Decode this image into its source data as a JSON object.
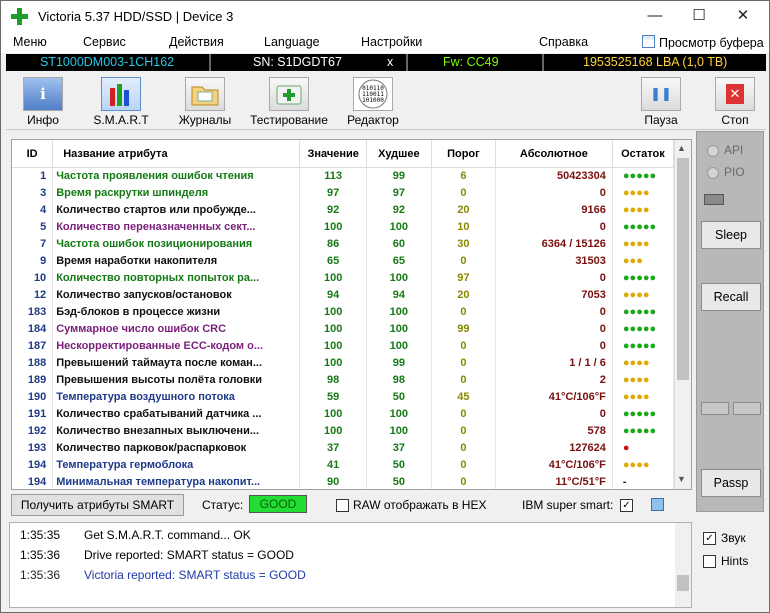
{
  "window": {
    "title": "Victoria 5.37 HDD/SSD | Device 3"
  },
  "menu": {
    "items": [
      "Меню",
      "Сервис",
      "Действия",
      "Language",
      "Настройки",
      "Справка"
    ],
    "buffer_view": "Просмотр буфера"
  },
  "device": {
    "model": "ST1000DM003-1CH162",
    "serial": "SN: S1DGDT67",
    "close": "x",
    "firmware": "Fw: CC49",
    "capacity": "1953525168 LBA (1,0 TB)"
  },
  "toolbar": {
    "info": "Инфо",
    "smart": "S.M.A.R.T",
    "logs": "Журналы",
    "test": "Тестирование",
    "editor": "Редактор",
    "pause": "Пауза",
    "stop": "Стоп",
    "editor_icon_text": "010110\n110011\n101000\n011011"
  },
  "table": {
    "headers": [
      "ID",
      "Название атрибута",
      "Значение",
      "Худшее",
      "Порог",
      "Абсолютное",
      "Остаток"
    ],
    "rows": [
      {
        "id": "1",
        "name": "Частота проявления ошибок чтения",
        "value": "113",
        "worst": "99",
        "thresh": "6",
        "abs": "50423304",
        "rem": "●●●●●",
        "nc": "#157a15",
        "rc": "#18a818"
      },
      {
        "id": "3",
        "name": "Время раскрутки шпинделя",
        "value": "97",
        "worst": "97",
        "thresh": "0",
        "abs": "0",
        "rem": "●●●●",
        "nc": "#157a15",
        "rc": "#e0a800"
      },
      {
        "id": "4",
        "name": "Количество стартов или пробужде...",
        "value": "92",
        "worst": "92",
        "thresh": "20",
        "abs": "9166",
        "rem": "●●●●",
        "nc": "#111",
        "rc": "#e0a800"
      },
      {
        "id": "5",
        "name": "Количество переназначенных сект...",
        "value": "100",
        "worst": "100",
        "thresh": "10",
        "abs": "0",
        "rem": "●●●●●",
        "nc": "#7a1f7a",
        "rc": "#18a818"
      },
      {
        "id": "7",
        "name": "Частота ошибок позиционирования",
        "value": "86",
        "worst": "60",
        "thresh": "30",
        "abs": "6364 / 15126",
        "rem": "●●●●",
        "nc": "#157a15",
        "rc": "#e0a800"
      },
      {
        "id": "9",
        "name": "Время наработки накопителя",
        "value": "65",
        "worst": "65",
        "thresh": "0",
        "abs": "31503",
        "rem": "●●●",
        "nc": "#111",
        "rc": "#e0a800"
      },
      {
        "id": "10",
        "name": "Количество повторных попыток ра...",
        "value": "100",
        "worst": "100",
        "thresh": "97",
        "abs": "0",
        "rem": "●●●●●",
        "nc": "#157a15",
        "rc": "#18a818"
      },
      {
        "id": "12",
        "name": "Количество запусков/остановок",
        "value": "94",
        "worst": "94",
        "thresh": "20",
        "abs": "7053",
        "rem": "●●●●",
        "nc": "#111",
        "rc": "#e0a800"
      },
      {
        "id": "183",
        "name": "Бэд-блоков в процессе жизни",
        "value": "100",
        "worst": "100",
        "thresh": "0",
        "abs": "0",
        "rem": "●●●●●",
        "nc": "#111",
        "rc": "#18a818"
      },
      {
        "id": "184",
        "name": "Суммарное число ошибок CRC",
        "value": "100",
        "worst": "100",
        "thresh": "99",
        "abs": "0",
        "rem": "●●●●●",
        "nc": "#7a1f7a",
        "rc": "#18a818"
      },
      {
        "id": "187",
        "name": "Нескорректированные ECC-кодом о...",
        "value": "100",
        "worst": "100",
        "thresh": "0",
        "abs": "0",
        "rem": "●●●●●",
        "nc": "#7a1f7a",
        "rc": "#18a818"
      },
      {
        "id": "188",
        "name": "Превышений таймаута после коман...",
        "value": "100",
        "worst": "99",
        "thresh": "0",
        "abs": "1 / 1 / 6",
        "rem": "●●●●",
        "nc": "#111",
        "rc": "#e0a800"
      },
      {
        "id": "189",
        "name": "Превышения высоты полёта головки",
        "value": "98",
        "worst": "98",
        "thresh": "0",
        "abs": "2",
        "rem": "●●●●",
        "nc": "#111",
        "rc": "#e0a800"
      },
      {
        "id": "190",
        "name": "Температура воздушного потока",
        "value": "59",
        "worst": "50",
        "thresh": "45",
        "abs": "41°C/106°F",
        "rem": "●●●●",
        "nc": "#1f3a8a",
        "rc": "#e0a800"
      },
      {
        "id": "191",
        "name": "Количество срабатываний датчика ...",
        "value": "100",
        "worst": "100",
        "thresh": "0",
        "abs": "0",
        "rem": "●●●●●",
        "nc": "#111",
        "rc": "#18a818"
      },
      {
        "id": "192",
        "name": "Количество внезапных выключени...",
        "value": "100",
        "worst": "100",
        "thresh": "0",
        "abs": "578",
        "rem": "●●●●●",
        "nc": "#111",
        "rc": "#18a818"
      },
      {
        "id": "193",
        "name": "Количество парковок/распарковок",
        "value": "37",
        "worst": "37",
        "thresh": "0",
        "abs": "127624",
        "rem": "●",
        "nc": "#111",
        "rc": "#cc1111"
      },
      {
        "id": "194",
        "name": "Температура гермоблока",
        "value": "41",
        "worst": "50",
        "thresh": "0",
        "abs": "41°C/106°F",
        "rem": "●●●●",
        "nc": "#1f3a8a",
        "rc": "#e0a800"
      },
      {
        "id": "194",
        "name": "Минимальная температура накопит...",
        "value": "90",
        "worst": "50",
        "thresh": "0",
        "abs": "11°C/51°F",
        "rem": "-",
        "nc": "#1f3a8a",
        "rc": "#111"
      }
    ]
  },
  "status": {
    "smart_button": "Получить атрибуты SMART",
    "label": "Статус:",
    "value": "GOOD",
    "raw_hex": "RAW отображать в HEX",
    "ibm": "IBM super smart:"
  },
  "side": {
    "api": "API",
    "pio": "PIO",
    "sleep": "Sleep",
    "recall": "Recall",
    "passp": "Passp"
  },
  "log": [
    {
      "time": "1:35:35",
      "text": "Get S.M.A.R.T. command... OK",
      "color": "#222"
    },
    {
      "time": "1:35:36",
      "text": "Drive reported: SMART status = GOOD",
      "color": "#222"
    },
    {
      "time": "1:35:36",
      "text": "Victoria reported: SMART status = GOOD",
      "color": "#1f3aa8"
    }
  ],
  "options": {
    "sound": "Звук",
    "hints": "Hints"
  },
  "colors": {
    "good_bg": "#22dd33",
    "model": "#28c6e6",
    "serial": "#ffffff",
    "firmware": "#7cfc00",
    "capacity": "#ffd23a"
  }
}
